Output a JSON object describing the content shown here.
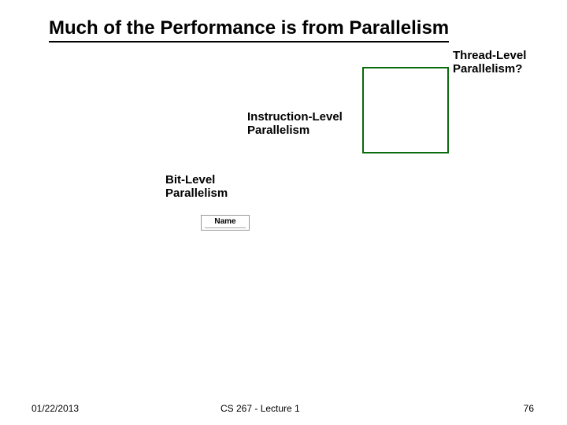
{
  "title": "Much of the Performance is from Parallelism",
  "labels": {
    "tlp_line1": "Thread-Level",
    "tlp_line2": "Parallelism?",
    "ilp_line1": "Instruction-Level",
    "ilp_line2": "Parallelism",
    "blp_line1": "Bit-Level",
    "blp_line2": "Parallelism"
  },
  "legend_name": "Name",
  "footer": {
    "date": "01/22/2013",
    "course": "CS 267 - Lecture 1",
    "page_number": "76"
  }
}
